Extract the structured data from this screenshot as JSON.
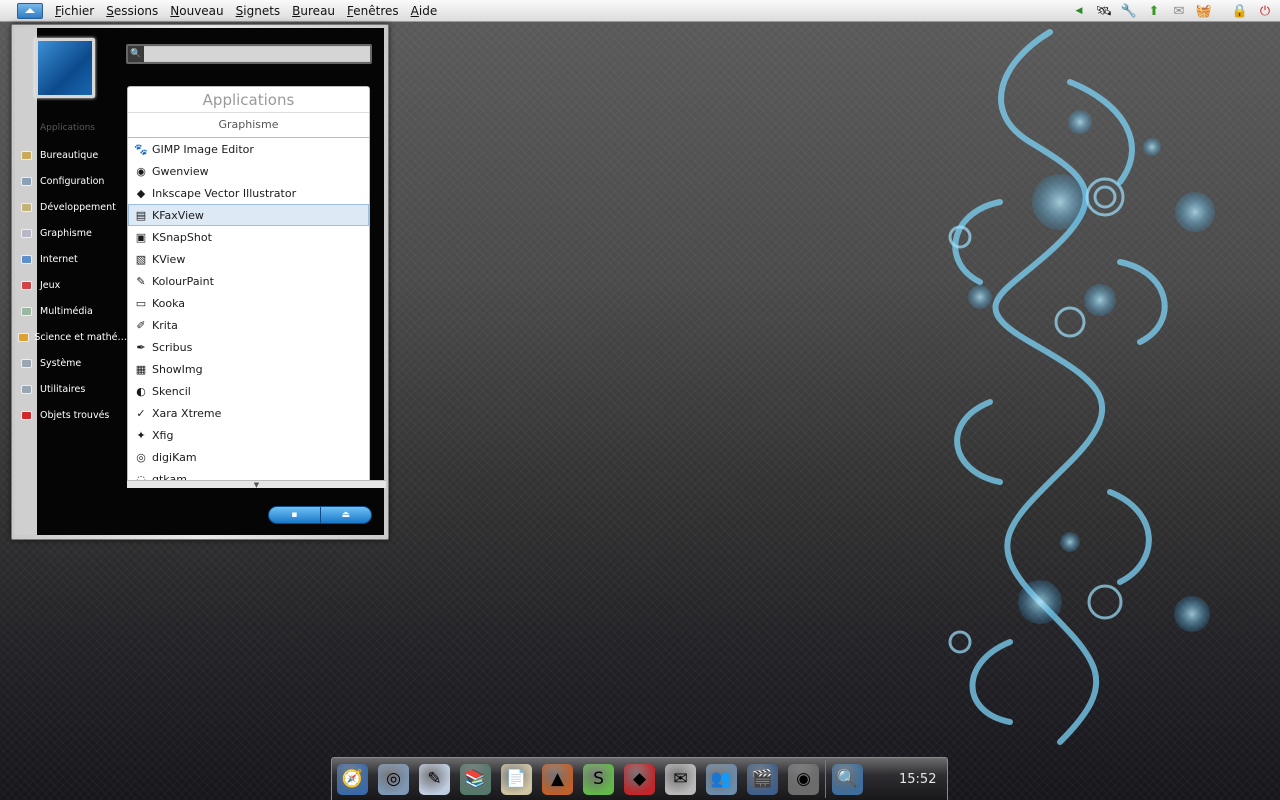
{
  "top_panel": {
    "menus": [
      "Fichier",
      "Sessions",
      "Nouveau",
      "Signets",
      "Bureau",
      "Fenêtres",
      "Aide"
    ],
    "tray_icons": [
      "left-arrow-icon",
      "network-icon",
      "tools-icon",
      "package-icon",
      "mail-icon",
      "basket-icon",
      "lock-icon",
      "logout-icon"
    ]
  },
  "launcher": {
    "search_placeholder": "",
    "categories_title": "Applications",
    "categories": [
      {
        "label": "Bureautique",
        "icon": "office-icon",
        "color": "#c9a95a"
      },
      {
        "label": "Configuration",
        "icon": "config-icon",
        "color": "#8aa0b5"
      },
      {
        "label": "Développement",
        "icon": "development-icon",
        "color": "#c4b27a"
      },
      {
        "label": "Graphisme",
        "icon": "graphics-icon",
        "color": "#b7b7c8"
      },
      {
        "label": "Internet",
        "icon": "internet-icon",
        "color": "#5c8fd0"
      },
      {
        "label": "Jeux",
        "icon": "games-icon",
        "color": "#d04545"
      },
      {
        "label": "Multimédia",
        "icon": "multimedia-icon",
        "color": "#9ab7a2"
      },
      {
        "label": "Science et mathé…",
        "icon": "science-icon",
        "color": "#e0a030"
      },
      {
        "label": "Système",
        "icon": "system-icon",
        "color": "#9aa6b3"
      },
      {
        "label": "Utilitaires",
        "icon": "utilities-icon",
        "color": "#9aa6b3"
      },
      {
        "label": "Objets trouvés",
        "icon": "lost-found-icon",
        "color": "#d02a2a"
      }
    ],
    "apps_header": "Applications",
    "apps_subheader": "Graphisme",
    "apps": [
      {
        "label": "GIMP Image Editor",
        "icon": "gimp-icon",
        "glyph": "🐾"
      },
      {
        "label": "Gwenview",
        "icon": "gwenview-icon",
        "glyph": "◉"
      },
      {
        "label": "Inkscape Vector Illustrator",
        "icon": "inkscape-icon",
        "glyph": "◆"
      },
      {
        "label": "KFaxView",
        "icon": "kfaxview-icon",
        "glyph": "▤",
        "selected": true
      },
      {
        "label": "KSnapShot",
        "icon": "ksnapshot-icon",
        "glyph": "▣"
      },
      {
        "label": "KView",
        "icon": "kview-icon",
        "glyph": "▧"
      },
      {
        "label": "KolourPaint",
        "icon": "kolourpaint-icon",
        "glyph": "✎"
      },
      {
        "label": "Kooka",
        "icon": "kooka-icon",
        "glyph": "▭"
      },
      {
        "label": "Krita",
        "icon": "krita-icon",
        "glyph": "✐"
      },
      {
        "label": "Scribus",
        "icon": "scribus-icon",
        "glyph": "✒"
      },
      {
        "label": "ShowImg",
        "icon": "showimg-icon",
        "glyph": "▦"
      },
      {
        "label": "Skencil",
        "icon": "skencil-icon",
        "glyph": "◐"
      },
      {
        "label": "Xara Xtreme",
        "icon": "xara-icon",
        "glyph": "✓"
      },
      {
        "label": "Xfig",
        "icon": "xfig-icon",
        "glyph": "✦"
      },
      {
        "label": "digiKam",
        "icon": "digikam-icon",
        "glyph": "◎"
      },
      {
        "label": "gtkam",
        "icon": "gtkam-icon",
        "glyph": "◌"
      }
    ],
    "scroll_glyph": "▼",
    "bottom_buttons": [
      {
        "name": "save-session-button",
        "glyph": "▪"
      },
      {
        "name": "eject-button",
        "glyph": "⏏"
      }
    ]
  },
  "dock": {
    "items": [
      {
        "name": "browser-icon",
        "glyph": "🧭",
        "bg": "#3a6aa8"
      },
      {
        "name": "media-icon",
        "glyph": "◎",
        "bg": "#7f99b5"
      },
      {
        "name": "editor-icon",
        "glyph": "✎",
        "bg": "#bfcde0"
      },
      {
        "name": "books-icon",
        "glyph": "📚",
        "bg": "#56786a"
      },
      {
        "name": "document-icon",
        "glyph": "📄",
        "bg": "#cfc4a3"
      },
      {
        "name": "chart-icon",
        "glyph": "▲",
        "bg": "#c0602a"
      },
      {
        "name": "skype-icon",
        "glyph": "S",
        "bg": "#64b84a"
      },
      {
        "name": "ruby-icon",
        "glyph": "◆",
        "bg": "#c0262a"
      },
      {
        "name": "mail-icon",
        "glyph": "✉",
        "bg": "#b9b9b9"
      },
      {
        "name": "contacts-icon",
        "glyph": "👥",
        "bg": "#6c8ca8"
      },
      {
        "name": "video-icon",
        "glyph": "🎬",
        "bg": "#3f5f8a"
      },
      {
        "name": "player-icon",
        "glyph": "◉",
        "bg": "#6c6c6c"
      }
    ],
    "extra_item": {
      "name": "search-app-icon",
      "glyph": "🔍",
      "bg": "#3d6e9d"
    },
    "clock": "15:52"
  },
  "colors": {
    "accent": "#2f7ec6",
    "selection": "#dde9f5"
  }
}
